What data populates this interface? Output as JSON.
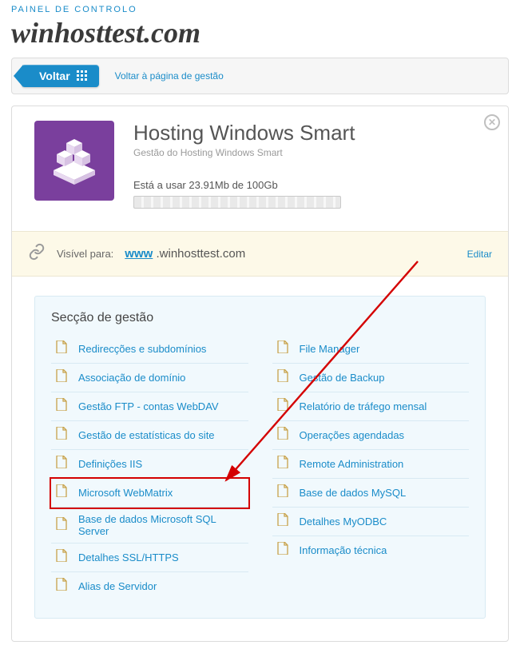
{
  "breadcrumb": "PAINEL DE CONTROLO",
  "page_title": "winhosttest.com",
  "back": {
    "button_label": "Voltar",
    "link_text": "Voltar à página de gestão"
  },
  "product": {
    "title": "Hosting Windows Smart",
    "subtitle": "Gestão do Hosting Windows Smart",
    "usage_text": "Está a usar 23.91Mb de 100Gb"
  },
  "visible": {
    "label": "Visível para:",
    "www": "www",
    "rest": " .winhosttest.com",
    "edit": "Editar"
  },
  "management": {
    "title": "Secção de gestão",
    "left": [
      "Redirecções e subdomínios",
      "Associação de domínio",
      "Gestão FTP - contas WebDAV",
      "Gestão de estatísticas do site",
      "Definições IIS",
      "Microsoft WebMatrix",
      "Base de dados Microsoft SQL Server",
      "Detalhes SSL/HTTPS",
      "Alias de Servidor"
    ],
    "right": [
      "File Manager",
      "Gestão de Backup",
      "Relatório de tráfego mensal",
      "Operações agendadas",
      "Remote Administration",
      "Base de dados MySQL",
      "Detalhes MyODBC",
      "Informação técnica"
    ],
    "highlighted_index_left": 5
  }
}
